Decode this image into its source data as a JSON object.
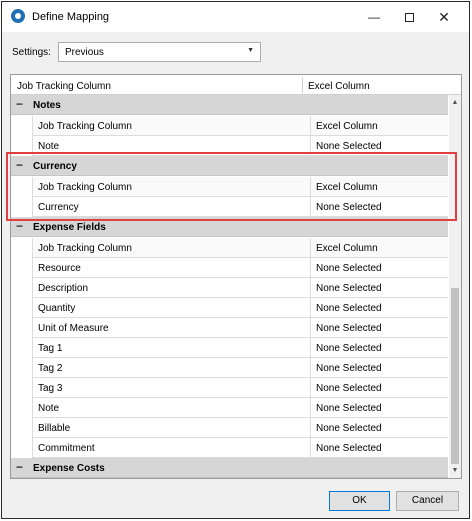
{
  "window": {
    "title": "Define Mapping"
  },
  "titlebar": {
    "minimize": "—",
    "close": "✕"
  },
  "settings": {
    "label": "Settings:",
    "value": "Previous",
    "arrow": "▼"
  },
  "grid": {
    "header": {
      "col1": "Job Tracking Column",
      "col2": "Excel Column"
    },
    "groups": [
      {
        "title": "Notes",
        "toggle": "−",
        "rows": [
          {
            "col1": "Job Tracking Column",
            "col2": "Excel Column"
          },
          {
            "col1": "Note",
            "col2": "None Selected"
          }
        ]
      },
      {
        "title": "Currency",
        "toggle": "−",
        "rows": [
          {
            "col1": "Job Tracking Column",
            "col2": "Excel Column"
          },
          {
            "col1": "Currency",
            "col2": "None Selected"
          }
        ]
      },
      {
        "title": "Expense Fields",
        "toggle": "−",
        "rows": [
          {
            "col1": "Job Tracking Column",
            "col2": "Excel Column"
          },
          {
            "col1": "Resource",
            "col2": "None Selected"
          },
          {
            "col1": "Description",
            "col2": "None Selected"
          },
          {
            "col1": "Quantity",
            "col2": "None Selected"
          },
          {
            "col1": "Unit of Measure",
            "col2": "None Selected"
          },
          {
            "col1": "Tag 1",
            "col2": "None Selected"
          },
          {
            "col1": "Tag 2",
            "col2": "None Selected"
          },
          {
            "col1": "Tag 3",
            "col2": "None Selected"
          },
          {
            "col1": "Note",
            "col2": "None Selected"
          },
          {
            "col1": "Billable",
            "col2": "None Selected"
          },
          {
            "col1": "Commitment",
            "col2": "None Selected"
          }
        ]
      },
      {
        "title": "Expense Costs",
        "toggle": "−",
        "rows": []
      }
    ],
    "scroll_up": "▲",
    "scroll_down": "▼"
  },
  "footer": {
    "ok_label": "OK",
    "cancel_label": "Cancel"
  },
  "colors": {
    "highlight": "#e04040",
    "group_bg": "#d6d6d6",
    "app_icon": "#1f6fb5"
  }
}
